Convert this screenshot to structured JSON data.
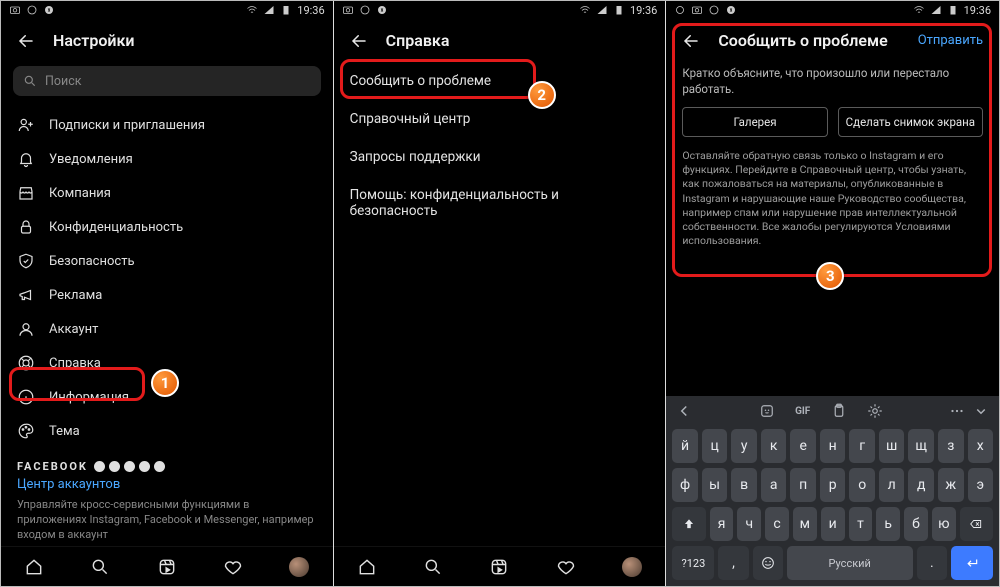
{
  "status": {
    "time": "19:36"
  },
  "screen1": {
    "title": "Настройки",
    "search_placeholder": "Поиск",
    "items": [
      {
        "label": "Подписки и приглашения"
      },
      {
        "label": "Уведомления"
      },
      {
        "label": "Компания"
      },
      {
        "label": "Конфиденциальность"
      },
      {
        "label": "Безопасность"
      },
      {
        "label": "Реклама"
      },
      {
        "label": "Аккаунт"
      },
      {
        "label": "Справка"
      },
      {
        "label": "Информация"
      },
      {
        "label": "Тема"
      }
    ],
    "fb": {
      "brand": "FACEBOOK",
      "accounts_center": "Центр аккаунтов",
      "desc": "Управляйте кросс-сервисными функциями в приложениях Instagram, Facebook и Messenger, например входом в аккаунт"
    }
  },
  "screen2": {
    "title": "Справка",
    "items": [
      "Сообщить о проблеме",
      "Справочный центр",
      "Запросы поддержки",
      "Помощь: конфиденциальность и безопасность"
    ]
  },
  "screen3": {
    "title": "Сообщить о проблеме",
    "send": "Отправить",
    "prompt": "Кратко объясните, что произошло или перестало работать.",
    "btn_gallery": "Галерея",
    "btn_shot": "Сделать снимок экрана",
    "note": "Оставляйте обратную связь только о Instagram и его функциях. Перейдите в Справочный центр, чтобы узнать, как пожаловаться на материалы, опубликованные в Instagram и нарушающие наше Руководство сообщества, например спам или нарушение прав интеллектуальной собственности. Все жалобы регулируются Условиями использования."
  },
  "keyboard": {
    "gif": "GIF",
    "row1": [
      "й",
      "ц",
      "у",
      "к",
      "е",
      "н",
      "г",
      "ш",
      "щ",
      "з",
      "х"
    ],
    "row2": [
      "ф",
      "ы",
      "в",
      "а",
      "п",
      "р",
      "о",
      "л",
      "д",
      "ж",
      "э"
    ],
    "row3": [
      "я",
      "ч",
      "с",
      "м",
      "и",
      "т",
      "ь",
      "б",
      "ю"
    ],
    "special": {
      "num": "?123",
      "comma": ",",
      "space": "Русский",
      "period": "."
    }
  },
  "badges": {
    "b1": "1",
    "b2": "2",
    "b3": "3"
  }
}
